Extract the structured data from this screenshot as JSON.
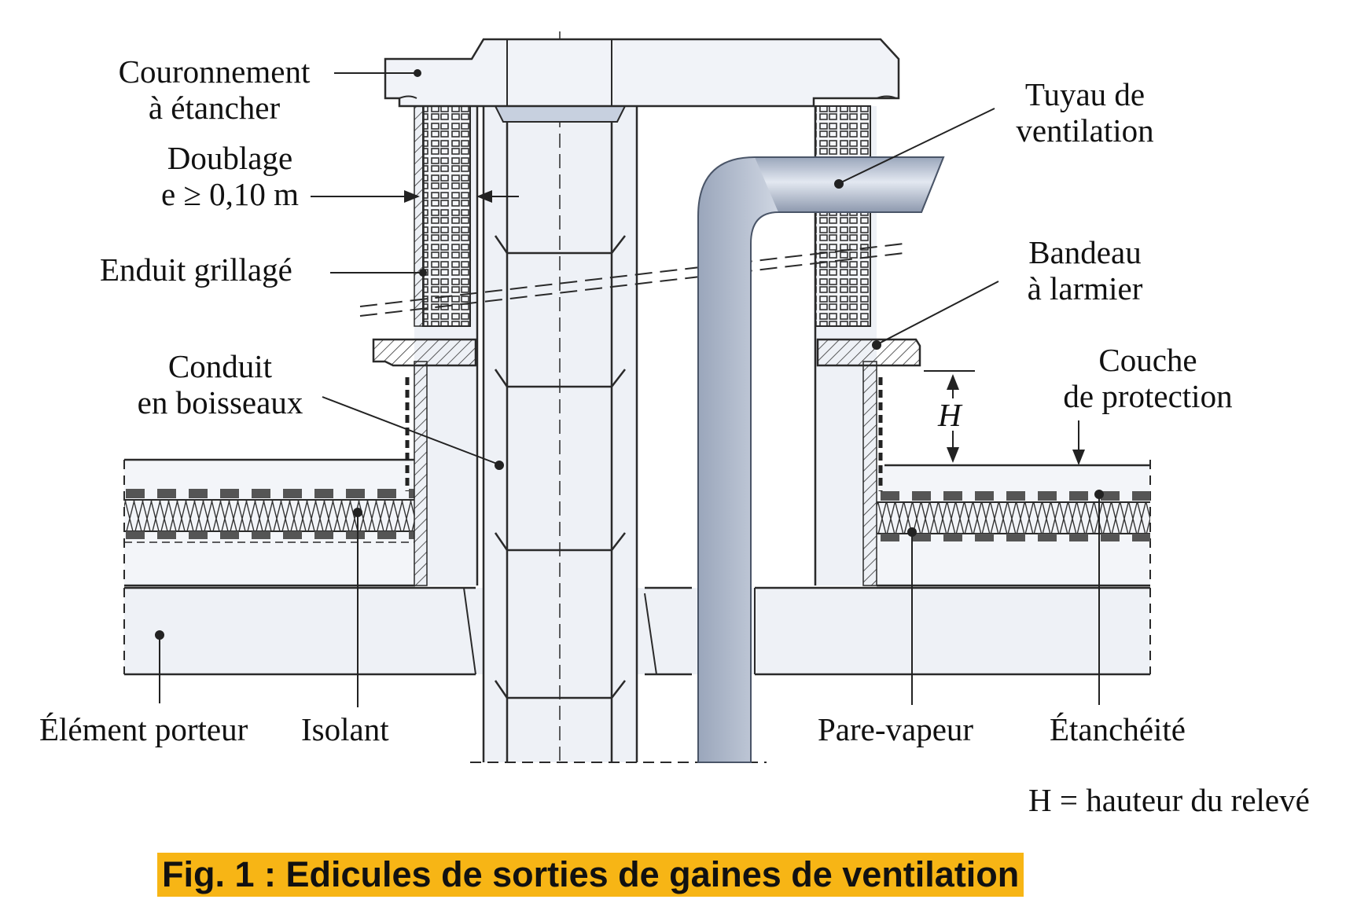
{
  "labels": {
    "couronnement_l1": "Couronnement",
    "couronnement_l2": "à étancher",
    "doublage_l1": "Doublage",
    "doublage_l2": "e ≥ 0,10 m",
    "enduit": "Enduit grillagé",
    "conduit_l1": "Conduit",
    "conduit_l2": "en boisseaux",
    "element_porteur": "Élément porteur",
    "isolant": "Isolant",
    "tuyau_l1": "Tuyau de",
    "tuyau_l2": "ventilation",
    "bandeau_l1": "Bandeau",
    "bandeau_l2": "à larmier",
    "couche_l1": "Couche",
    "couche_l2": "de protection",
    "h_marker": "H",
    "pare_vapeur": "Pare-vapeur",
    "etancheite": "Étanchéité",
    "h_def": "H = hauteur du relevé"
  },
  "caption": "Fig. 1 : Edicules de sorties de gaines de ventilation",
  "colors": {
    "caption_highlight": "#f7b515",
    "line": "#2a2a2a",
    "fill_concrete": "#eef1f6",
    "pipe": "#c7d0df"
  }
}
